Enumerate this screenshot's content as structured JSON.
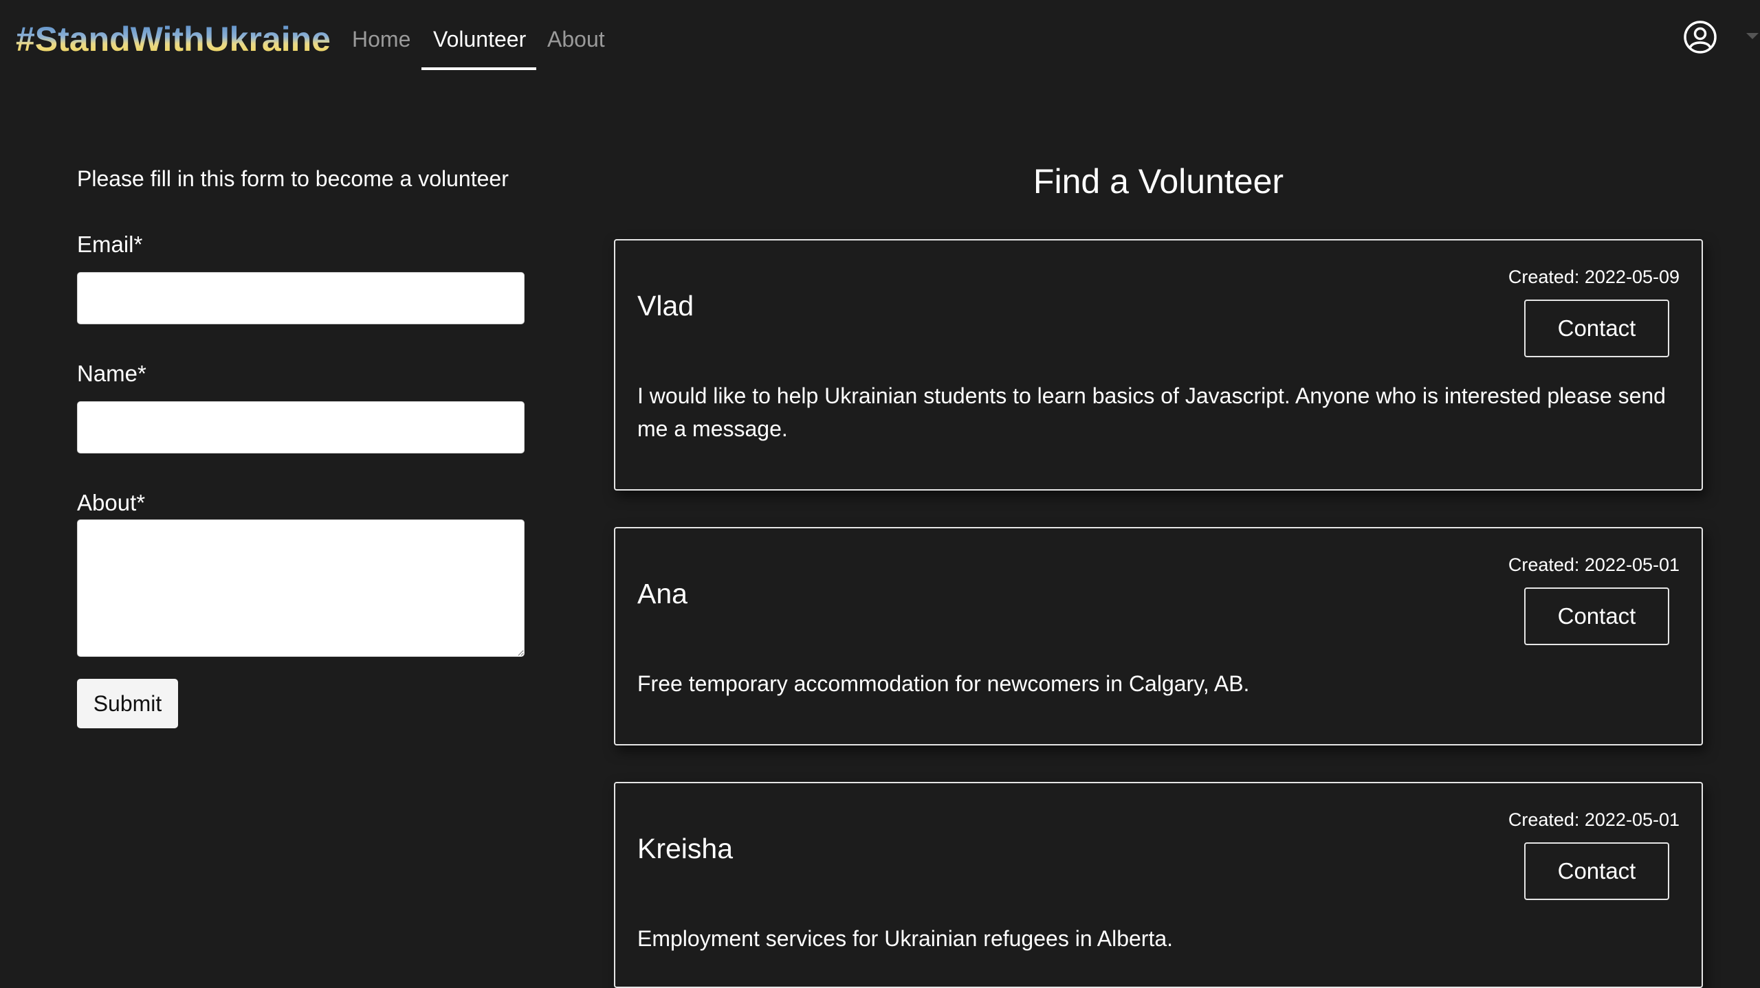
{
  "navbar": {
    "brand": "#StandWithUkraine",
    "links": [
      {
        "label": "Home",
        "active": false
      },
      {
        "label": "Volunteer",
        "active": true
      },
      {
        "label": "About",
        "active": false
      }
    ],
    "account_icon": "user-circle-icon"
  },
  "form": {
    "intro": "Please fill in this form to become a volunteer",
    "email_label": "Email*",
    "email_value": "",
    "name_label": "Name*",
    "name_value": "",
    "about_label": "About*",
    "about_value": "",
    "submit_label": "Submit"
  },
  "listings": {
    "title": "Find a Volunteer",
    "contact_label": "Contact",
    "items": [
      {
        "name": "Vlad",
        "created": "Created: 2022-05-09",
        "description": "I would like to help Ukrainian students to learn basics of Javascript. Anyone who is interested please send me a message."
      },
      {
        "name": "Ana",
        "created": "Created: 2022-05-01",
        "description": "Free temporary accommodation for newcomers in Calgary, AB."
      },
      {
        "name": "Kreisha",
        "created": "Created: 2022-05-01",
        "description": "Employment services for Ukrainian refugees in Alberta."
      }
    ]
  },
  "colors": {
    "background": "#1c1c1c",
    "text": "#ffffff",
    "inactive_link": "#9a9a9a",
    "brand_blue": "#3f7cc3",
    "brand_yellow": "#f5d23b"
  }
}
